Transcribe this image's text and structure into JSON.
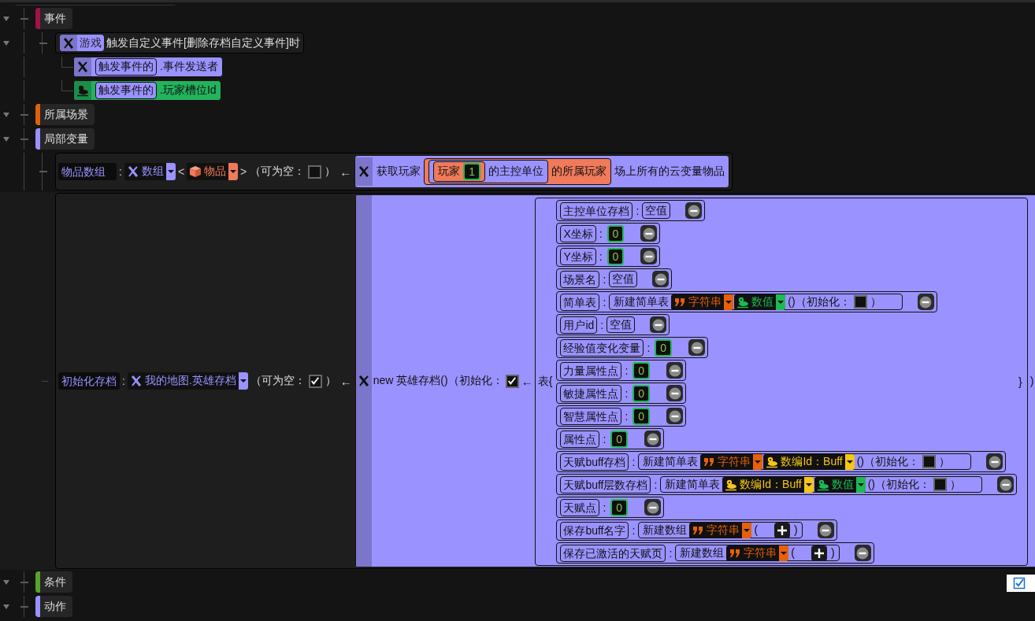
{
  "sections": [
    {
      "label": "事件",
      "color": "#a0124a",
      "expanded": true,
      "event": {
        "expanded": true,
        "kind": "function",
        "tag": "游戏",
        "text": "触发自定义事件[删除存档自定义事件]时",
        "params": [
          {
            "kind": "function_call",
            "color": "#9a92ff",
            "parts": [
              {
                "kind": "call",
                "color": "#9a92ff",
                "parts": [
                  {
                    "kind": "text",
                    "text": "触发事件的"
                  }
                ]
              },
              {
                "kind": "text",
                "text": ".事件发送者"
              }
            ]
          },
          {
            "kind": "value_call",
            "color": "#22b35c",
            "parts": [
              {
                "kind": "call",
                "color": "#9a92ff",
                "parts": [
                  {
                    "kind": "text",
                    "text": "触发事件的"
                  }
                ]
              },
              {
                "kind": "text",
                "text": ".玩家槽位Id"
              }
            ]
          }
        ]
      }
    },
    {
      "label": "所属场景",
      "color": "#e0600e",
      "expanded": true
    },
    {
      "label": "局部变量",
      "color": "#9a92ff",
      "expanded": true,
      "variables": [
        {
          "name": "物品数组",
          "sep": ":",
          "type": {
            "kind": "function",
            "label": "数组",
            "color": "#9a92ff"
          },
          "generic_open": "<",
          "generic": {
            "kind": "item",
            "label": "物品",
            "color": "#f07a5a"
          },
          "generic_close": ">",
          "nullable_label": "（可为空：",
          "nullable": false,
          "nullable_close": "）",
          "arrow": "←",
          "value": {
            "kind": "function_call",
            "color": "#9a92ff",
            "parts": [
              {
                "kind": "text",
                "text": "获取玩家"
              },
              {
                "kind": "call",
                "color": "#f07a5a",
                "parts": [
                  {
                    "kind": "call",
                    "color": "#9a92ff",
                    "parts": [
                      {
                        "kind": "call",
                        "color": "#f07a5a",
                        "parts": [
                          {
                            "kind": "text",
                            "text": "玩家"
                          },
                          {
                            "kind": "number",
                            "value": "1"
                          }
                        ]
                      },
                      {
                        "kind": "text",
                        "text": "的主控单位"
                      }
                    ]
                  },
                  {
                    "kind": "text",
                    "text": "的所属玩家"
                  }
                ]
              },
              {
                "kind": "text",
                "text": "场上所有的云变量物品"
              }
            ]
          }
        },
        {
          "name": "初始化存档",
          "sep": ":",
          "type": {
            "kind": "function",
            "label": "我的地图.英雄存档",
            "color": "#9a92ff"
          },
          "nullable_label": "（可为空：",
          "nullable": true,
          "nullable_close": "）",
          "arrow": "←",
          "value": {
            "kind": "constructor",
            "color": "#9a92ff",
            "text": "new 英雄存档()（初始化：",
            "initialized": true,
            "arrow": "←",
            "open": "表{",
            "close": "}",
            "end": ")",
            "fields": [
              {
                "key": "主控单位存档",
                "sep": ":",
                "value": {
                  "kind": "null",
                  "text": "空值"
                }
              },
              {
                "key": "X坐标",
                "sep": ":",
                "value": {
                  "kind": "number",
                  "value": "0"
                }
              },
              {
                "key": "Y坐标",
                "sep": ":",
                "value": {
                  "kind": "number",
                  "value": "0"
                }
              },
              {
                "key": "场景名",
                "sep": ":",
                "value": {
                  "kind": "null",
                  "text": "空值"
                }
              },
              {
                "key": "简单表",
                "sep": ":",
                "value": {
                  "kind": "map",
                  "label": "新建简单表",
                  "key_type": {
                    "kind": "string",
                    "label": "字符串",
                    "color": "#e8600a"
                  },
                  "value_type": {
                    "kind": "number",
                    "label": "数值",
                    "color": "#1db954"
                  },
                  "suffix": "()（初始化：",
                  "initialized": false,
                  "close": "）"
                }
              },
              {
                "key": "用户id",
                "sep": ":",
                "value": {
                  "kind": "null",
                  "text": "空值"
                }
              },
              {
                "key": "经验值变化变量",
                "sep": ":",
                "value": {
                  "kind": "number",
                  "value": "0"
                }
              },
              {
                "key": "力量属性点",
                "sep": ":",
                "value": {
                  "kind": "number",
                  "value": "0"
                }
              },
              {
                "key": "敏捷属性点",
                "sep": ":",
                "value": {
                  "kind": "number",
                  "value": "0"
                }
              },
              {
                "key": "智慧属性点",
                "sep": ":",
                "value": {
                  "kind": "number",
                  "value": "0"
                }
              },
              {
                "key": "属性点",
                "sep": ":",
                "value": {
                  "kind": "number",
                  "value": "0"
                }
              },
              {
                "key": "天赋buff存档",
                "sep": ":",
                "value": {
                  "kind": "map",
                  "label": "新建简单表",
                  "key_type": {
                    "kind": "string",
                    "label": "字符串",
                    "color": "#e8600a"
                  },
                  "value_type": {
                    "kind": "number",
                    "label": "数编Id：Buff",
                    "color": "#f5c518"
                  },
                  "suffix": "()（初始化：",
                  "initialized": false,
                  "close": "）"
                }
              },
              {
                "key": "天赋buff层数存档",
                "sep": ":",
                "value": {
                  "kind": "map",
                  "label": "新建简单表",
                  "key_type": {
                    "kind": "number",
                    "label": "数编Id：Buff",
                    "color": "#f5c518"
                  },
                  "value_type": {
                    "kind": "number",
                    "label": "数值",
                    "color": "#1db954"
                  },
                  "suffix": "()（初始化：",
                  "initialized": false,
                  "close": "）"
                }
              },
              {
                "key": "天赋点",
                "sep": ":",
                "value": {
                  "kind": "number",
                  "value": "0"
                }
              },
              {
                "key": "保存buff名字",
                "sep": ":",
                "value": {
                  "kind": "array",
                  "label": "新建数组",
                  "item_type": {
                    "kind": "string",
                    "label": "字符串",
                    "color": "#e8600a"
                  },
                  "open": "(",
                  "close": ")"
                }
              },
              {
                "key": "保存已激活的天赋页",
                "sep": ":",
                "value": {
                  "kind": "array",
                  "label": "新建数组",
                  "item_type": {
                    "kind": "string",
                    "label": "字符串",
                    "color": "#e8600a"
                  },
                  "open": "(",
                  "close": ")"
                }
              }
            ]
          }
        }
      ]
    },
    {
      "label": "条件",
      "color": "#5aa02c",
      "expanded": true
    },
    {
      "label": "动作",
      "color": "#9a92ff",
      "expanded": true
    }
  ]
}
